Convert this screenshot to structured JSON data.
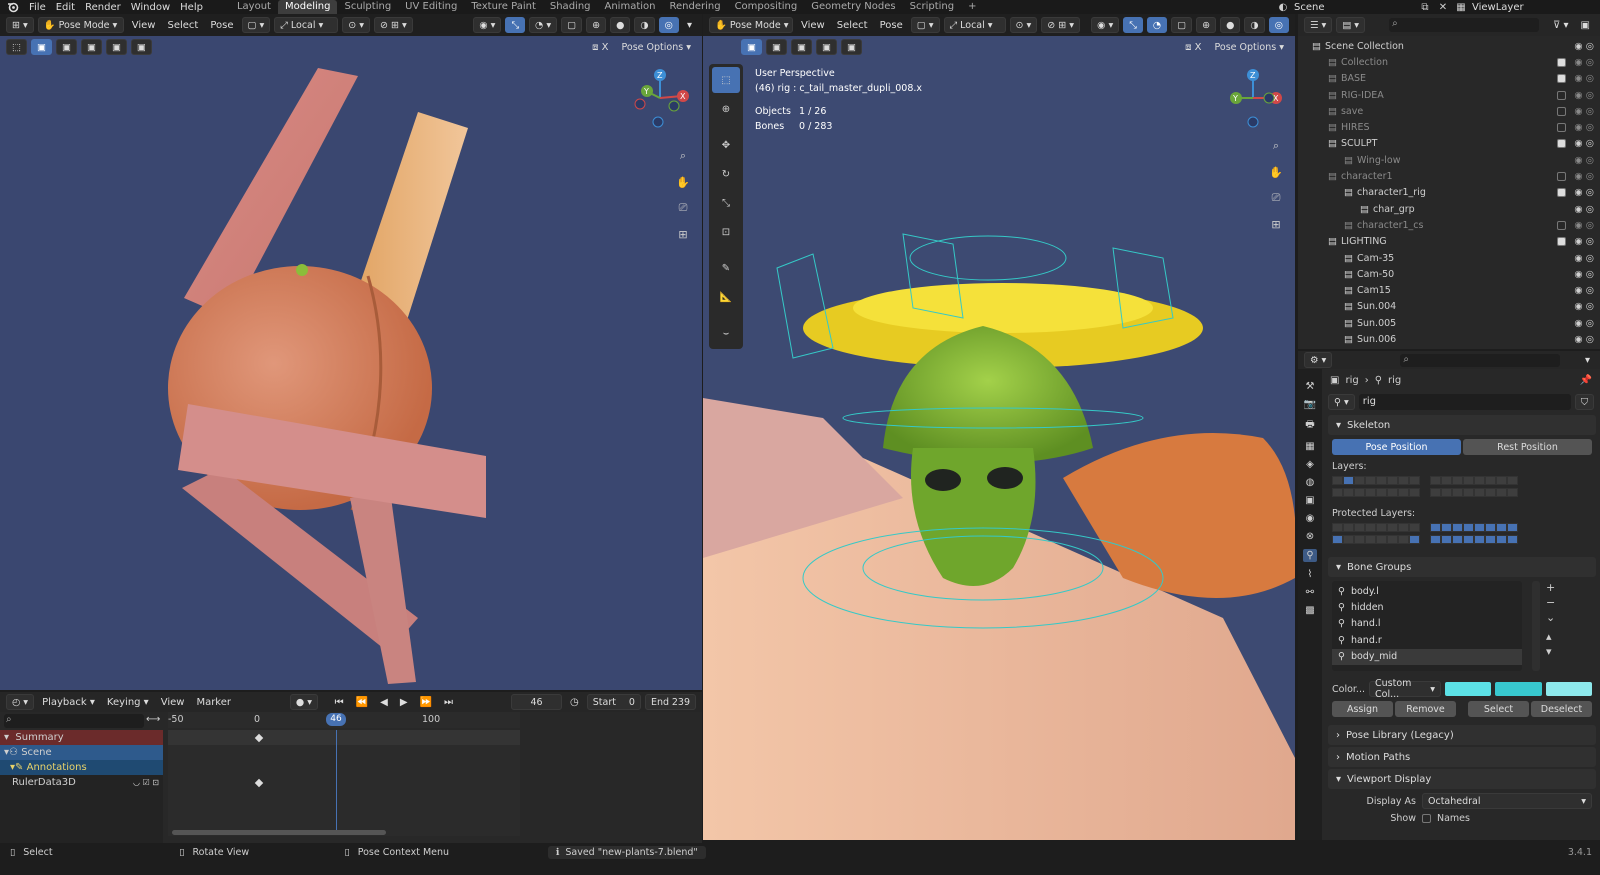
{
  "top_menu": {
    "menus": [
      "File",
      "Edit",
      "Render",
      "Window",
      "Help"
    ],
    "workspaces": [
      "Layout",
      "Modeling",
      "Sculpting",
      "UV Editing",
      "Texture Paint",
      "Shading",
      "Animation",
      "Rendering",
      "Compositing",
      "Geometry Nodes",
      "Scripting"
    ],
    "active_workspace": "Modeling",
    "plus": "+",
    "scene": "Scene",
    "view_layer": "ViewLayer"
  },
  "left_viewport": {
    "mode": "Pose Mode",
    "menus": [
      "View",
      "Select",
      "Pose"
    ],
    "orientation": "Local",
    "options": "Pose Options",
    "axes": [
      "X",
      "Y",
      "Z"
    ]
  },
  "right_viewport": {
    "mode": "Pose Mode",
    "menus": [
      "View",
      "Select",
      "Pose"
    ],
    "orientation": "Local",
    "options": "Pose Options",
    "perspective": "User Perspective",
    "active": "(46) rig : c_tail_master_dupli_008.x",
    "objects_label": "Objects",
    "objects_value": "1 / 26",
    "bones_label": "Bones",
    "bones_value": "0 / 283",
    "axes": [
      "X",
      "Y",
      "Z"
    ]
  },
  "timeline": {
    "menus": [
      "Playback",
      "Keying",
      "View",
      "Marker"
    ],
    "current_frame": "46",
    "start_label": "Start",
    "start": "0",
    "end_label": "End",
    "end": "239",
    "ticks": [
      "-50",
      "0",
      "46",
      "100"
    ],
    "channels": [
      "Summary",
      "Scene",
      "Annotations",
      "RulerData3D"
    ]
  },
  "outliner": {
    "items": [
      {
        "label": "Scene Collection",
        "indent": 0
      },
      {
        "label": "Collection",
        "indent": 1,
        "dim": true,
        "check": true
      },
      {
        "label": "BASE",
        "indent": 1,
        "dim": true,
        "check": true
      },
      {
        "label": "RIG-IDEA",
        "indent": 1,
        "dim": true,
        "check": false
      },
      {
        "label": "save",
        "indent": 1,
        "dim": true,
        "check": false
      },
      {
        "label": "HIRES",
        "indent": 1,
        "dim": true,
        "check": false
      },
      {
        "label": "SCULPT",
        "indent": 1,
        "dim": false,
        "check": true
      },
      {
        "label": "Wing-low",
        "indent": 2,
        "dim": true
      },
      {
        "label": "character1",
        "indent": 1,
        "dim": true,
        "check": false
      },
      {
        "label": "character1_rig",
        "indent": 2,
        "dim": false,
        "check": true
      },
      {
        "label": "char_grp",
        "indent": 3,
        "dim": false
      },
      {
        "label": "character1_cs",
        "indent": 2,
        "dim": true,
        "check": false
      },
      {
        "label": "LIGHTING",
        "indent": 1,
        "dim": false,
        "check": true
      },
      {
        "label": "Cam-35",
        "indent": 2,
        "dim": false
      },
      {
        "label": "Cam-50",
        "indent": 2,
        "dim": false
      },
      {
        "label": "Cam15",
        "indent": 2,
        "dim": false
      },
      {
        "label": "Sun.004",
        "indent": 2,
        "dim": false
      },
      {
        "label": "Sun.005",
        "indent": 2,
        "dim": false
      },
      {
        "label": "Sun.006",
        "indent": 2,
        "dim": false
      }
    ]
  },
  "properties": {
    "breadcrumb_a": "rig",
    "breadcrumb_b": "rig",
    "data_name": "rig",
    "skeleton": "Skeleton",
    "pose_position": "Pose Position",
    "rest_position": "Rest Position",
    "layers": "Layers:",
    "protected_layers": "Protected Layers:",
    "bone_groups": "Bone Groups",
    "groups": [
      "body.l",
      "hidden",
      "hand.l",
      "hand.r",
      "body_mid"
    ],
    "color_label": "Color...",
    "color_set": "Custom Col...",
    "assign": "Assign",
    "remove": "Remove",
    "select": "Select",
    "deselect": "Deselect",
    "pose_library": "Pose Library (Legacy)",
    "motion_paths": "Motion Paths",
    "viewport_display": "Viewport Display",
    "display_as_label": "Display As",
    "display_as": "Octahedral",
    "show_label": "Show",
    "names": "Names",
    "swatch_colors": [
      "#5ce1e6",
      "#38c8cf",
      "#8ee9ec"
    ]
  },
  "status": {
    "select": "Select",
    "rotate": "Rotate View",
    "context": "Pose Context Menu",
    "message": "Saved \"new-plants-7.blend\"",
    "version": "3.4.1"
  }
}
